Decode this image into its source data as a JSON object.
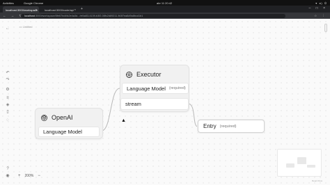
{
  "os": {
    "activities": "Activities",
    "app_name": "Google Chrome",
    "clock": "abr 11  20:42",
    "tray": "▾ ◂) ⏻"
  },
  "browser": {
    "tabs": [
      {
        "label": "localhost:3000/workspace"
      },
      {
        "label": "localhost:3000/code/api"
      }
    ],
    "url_host": "localhost",
    "url_path": ":3000/workspace/5fe67bd4fc2e4a3d.../ef4a53-4139-b3f2-08fc2d89211-fb3f7ea8d9a8bcd1b1"
  },
  "page": {
    "breadcrumb": "Untitled",
    "zoom_label": "200%",
    "minimap_caption": "React Flow"
  },
  "nodes": {
    "openai": {
      "title": "OpenAI",
      "output_label": "Language Model"
    },
    "executor": {
      "title": "Executor",
      "input_label": "Language Model",
      "input_required": "(required)",
      "output_label": "stream"
    },
    "entry": {
      "label": "Entry",
      "required": "(required)"
    }
  },
  "colors": {
    "canvas": "#fafafa",
    "node_bg": "#f1f1f1",
    "edge": "#b8b8b8"
  }
}
